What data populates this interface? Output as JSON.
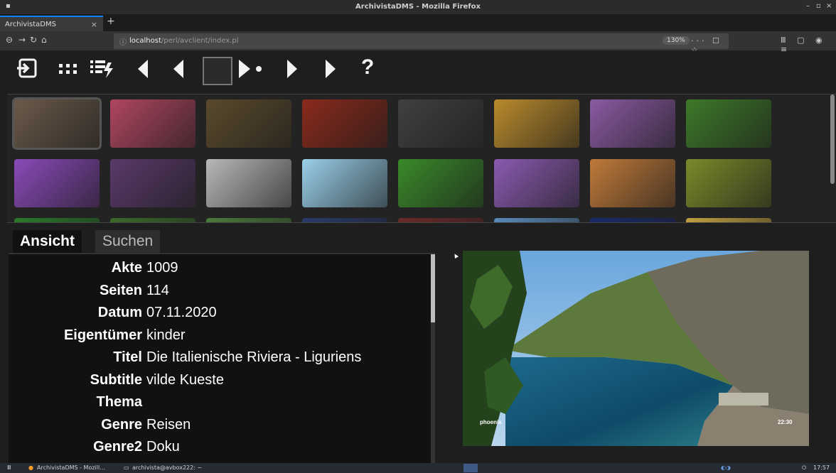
{
  "window": {
    "title": "ArchivistaDMS - Mozilla Firefox"
  },
  "browser": {
    "tab_label": "ArchivistaDMS",
    "url_host": "localhost",
    "url_path": "/perl/avclient/index.pl",
    "zoom": "130%"
  },
  "toolbar": {
    "icons": [
      "logout-icon",
      "grid-icon",
      "list-action-icon",
      "first-icon",
      "previous-icon",
      "page-box",
      "play-icon",
      "next-icon",
      "last-icon",
      "help-icon"
    ],
    "help_label": "?"
  },
  "thumbnails": {
    "row1_colors": [
      "#6b5a4a",
      "#b04660",
      "#5a4a2c",
      "#8a2a1c",
      "#404040",
      "#b98a2c",
      "#8a5aa2",
      "#3e7a2a"
    ],
    "row2_colors": [
      "#8a4ab8",
      "#5a3a6a",
      "#b8b8b8",
      "#9ad0ea",
      "#3a8a2a",
      "#8a5ab0",
      "#c07a3a",
      "#7a8a2a"
    ],
    "row3_colors": [
      "#2a7a2a",
      "#3a6a2a",
      "#4a7a3a",
      "#2a3a6a",
      "#6a2a2a",
      "#5a8aba",
      "#1a2a6a",
      "#c0a040"
    ]
  },
  "panel_tabs": {
    "active": "Ansicht",
    "inactive": "Suchen"
  },
  "fields": [
    {
      "label": "Akte",
      "value": "1009"
    },
    {
      "label": "Seiten",
      "value": "114"
    },
    {
      "label": "Datum",
      "value": "07.11.2020"
    },
    {
      "label": "Eigentümer",
      "value": "kinder"
    },
    {
      "label": "Titel",
      "value": "Die Italienische Riviera - Liguriens"
    },
    {
      "label": "Subtitle",
      "value": "vilde Kueste"
    },
    {
      "label": "Thema",
      "value": ""
    },
    {
      "label": "Genre",
      "value": "Reisen"
    },
    {
      "label": "Genre2",
      "value": "Doku"
    }
  ],
  "preview": {
    "channel": "phoenix",
    "time": "22:30"
  },
  "taskbar": {
    "item1": "ArchivistaDMS - Mozill...",
    "item2": "archivista@avbox222: ~",
    "clock": "17:57"
  }
}
